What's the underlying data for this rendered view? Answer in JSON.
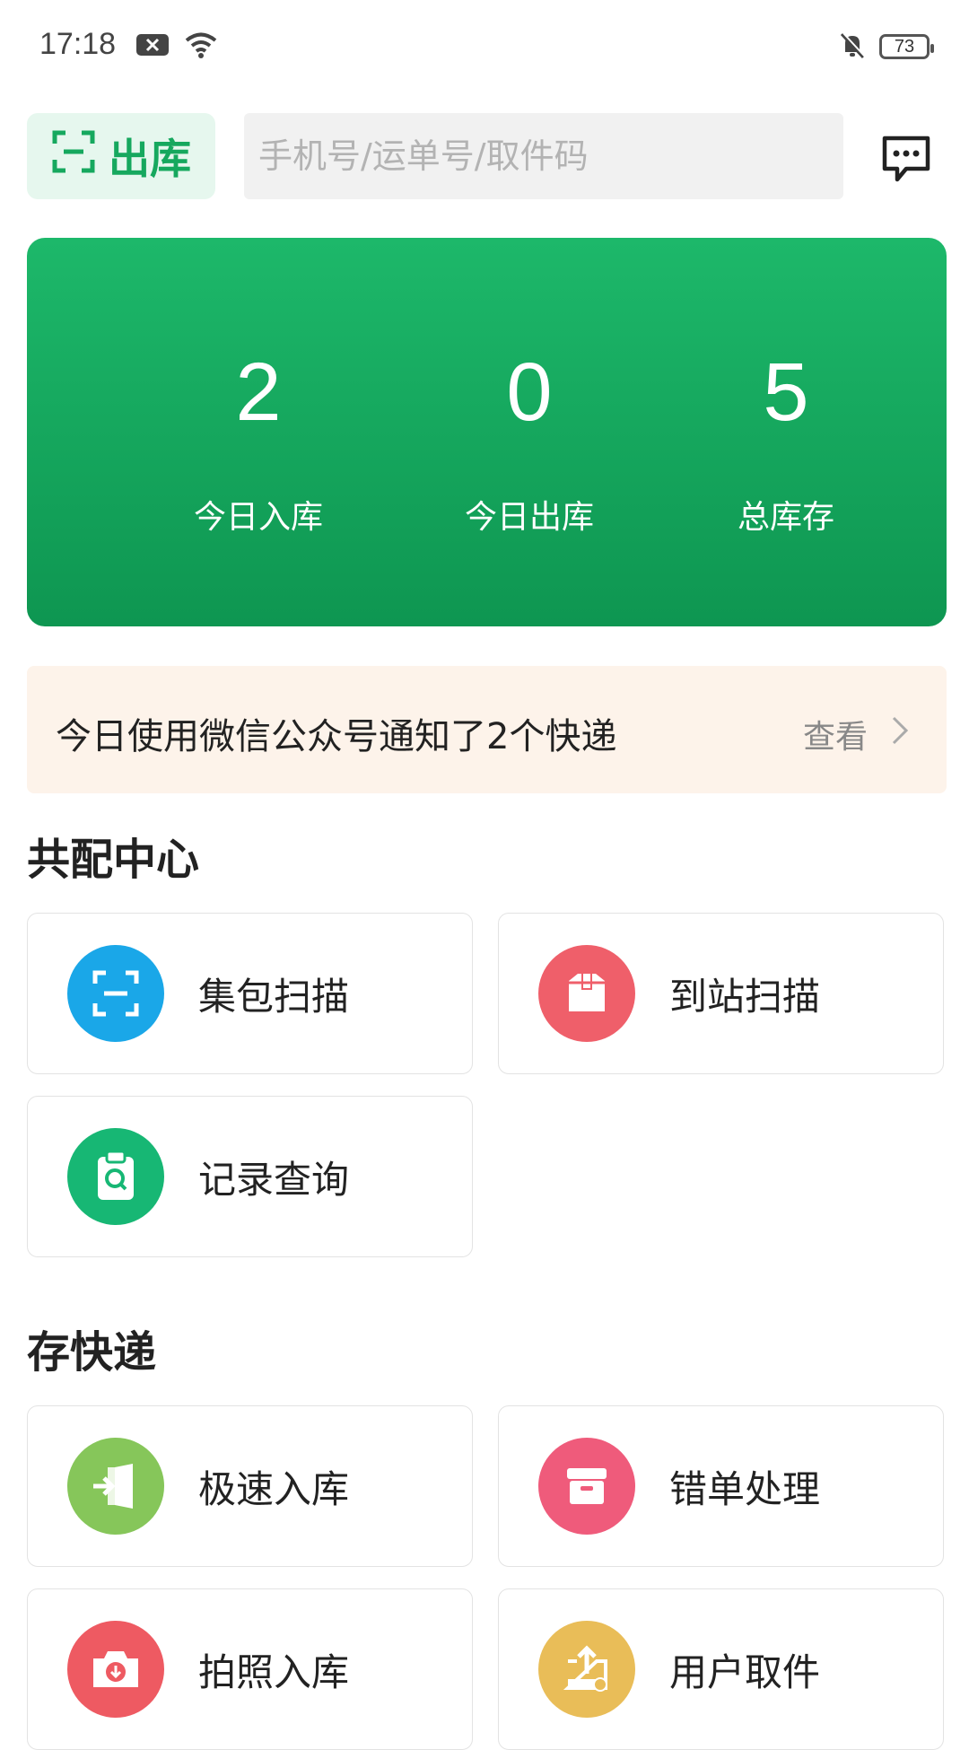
{
  "status_bar": {
    "time": "17:18",
    "battery": "73"
  },
  "header": {
    "outbound_label": "出库",
    "search_placeholder": "手机号/运单号/取件码"
  },
  "stats": [
    {
      "value": "2",
      "label": "今日入库"
    },
    {
      "value": "0",
      "label": "今日出库"
    },
    {
      "value": "5",
      "label": "总库存"
    }
  ],
  "notice": {
    "text": "今日使用微信公众号通知了2个快递",
    "link": "查看"
  },
  "sections": {
    "shared": {
      "title": "共配中心",
      "items": [
        {
          "label": "集包扫描",
          "icon": "scan-icon",
          "color": "#1aa7e8"
        },
        {
          "label": "到站扫描",
          "icon": "box-icon",
          "color": "#ef5f6a"
        },
        {
          "label": "记录查询",
          "icon": "clipboard-search-icon",
          "color": "#17b774"
        }
      ]
    },
    "store": {
      "title": "存快递",
      "items": [
        {
          "label": "极速入库",
          "icon": "enter-door-icon",
          "color": "#86c65a"
        },
        {
          "label": "错单处理",
          "icon": "archive-box-icon",
          "color": "#ef5b7b"
        },
        {
          "label": "拍照入库",
          "icon": "camera-icon",
          "color": "#ee5a62"
        },
        {
          "label": "用户取件",
          "icon": "pickup-upload-icon",
          "color": "#e9bd58"
        }
      ]
    }
  }
}
